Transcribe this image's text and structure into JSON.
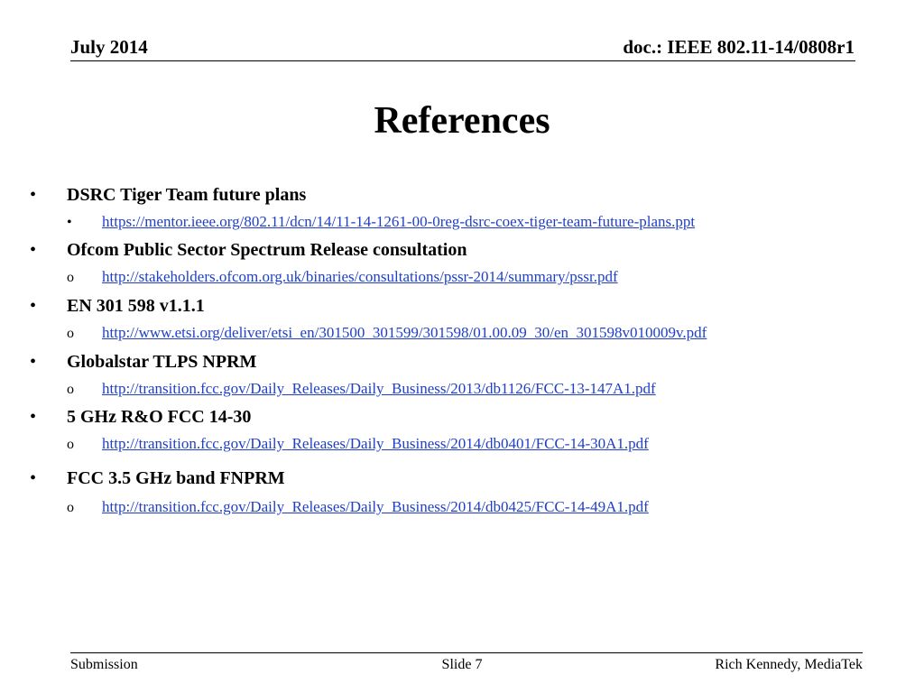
{
  "header": {
    "date": "July 2014",
    "doc_id": "doc.: IEEE 802.11-14/0808r1"
  },
  "title": "References",
  "references": [
    {
      "bullet": "•",
      "title": "DSRC Tiger Team future plans",
      "sub_bullet": "•",
      "url": "https://mentor.ieee.org/802.11/dcn/14/11-14-1261-00-0reg-dsrc-coex-tiger-team-future-plans.ppt"
    },
    {
      "bullet": "•",
      "title": "Ofcom Public Sector Spectrum Release consultation",
      "sub_bullet": "o",
      "url": "http://stakeholders.ofcom.org.uk/binaries/consultations/pssr-2014/summary/pssr.pdf"
    },
    {
      "bullet": "•",
      "title": "EN 301 598 v1.1.1",
      "sub_bullet": "o",
      "url": "http://www.etsi.org/deliver/etsi_en/301500_301599/301598/01.00.09_30/en_301598v010009v.pdf"
    },
    {
      "bullet": "•",
      "title": "Globalstar TLPS NPRM",
      "sub_bullet": "o",
      "url": "http://transition.fcc.gov/Daily_Releases/Daily_Business/2013/db1126/FCC-13-147A1.pdf"
    },
    {
      "bullet": "•",
      "title": "5 GHz R&O FCC 14-30",
      "sub_bullet": "o",
      "url": "http://transition.fcc.gov/Daily_Releases/Daily_Business/2014/db0401/FCC-14-30A1.pdf"
    },
    {
      "bullet": "•",
      "title": "FCC 3.5 GHz band FNPRM",
      "sub_bullet": "o",
      "url": "http://transition.fcc.gov/Daily_Releases/Daily_Business/2014/db0425/FCC-14-49A1.pdf"
    }
  ],
  "footer": {
    "left": "Submission",
    "center": "Slide 7",
    "right": "Rich Kennedy, MediaTek"
  },
  "colors": {
    "link": "#1f3fc8",
    "text": "#000000",
    "background": "#ffffff"
  }
}
